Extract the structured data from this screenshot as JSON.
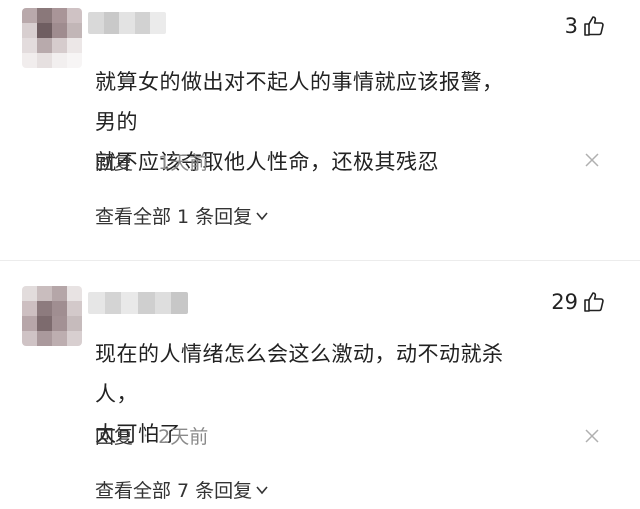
{
  "comments": [
    {
      "likes": "3",
      "text_line1": "就算女的做出对不起人的事情就应该报警，男的",
      "text_line2": "就不应该夺取他人性命，还极其残忍",
      "reply_label": "回复",
      "separator": "·",
      "time": "1天前",
      "view_all": "查看全部 1 条回复"
    },
    {
      "likes": "29",
      "text_line1": "现在的人情绪怎么会这么激动，动不动就杀人，",
      "text_line2": "太可怕了",
      "reply_label": "回复",
      "separator": "·",
      "time": "2天前",
      "view_all": "查看全部 7 条回复"
    }
  ],
  "icons": {
    "like": "thumbs-up-icon",
    "close": "close-icon",
    "expand": "chevron-down-icon"
  },
  "colors": {
    "text": "#222222",
    "muted": "#8a8a8a"
  }
}
